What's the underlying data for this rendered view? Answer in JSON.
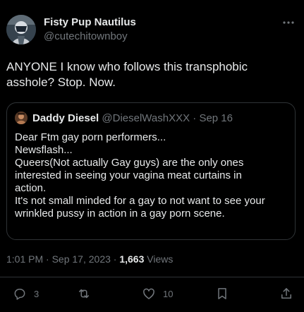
{
  "author": {
    "name": "Fisty Pup Nautilus",
    "handle": "@cutechitownboy",
    "avatar_icon": "profile-photo"
  },
  "more_icon": "more-horizontal-icon",
  "tweet": {
    "text": "ANYONE I know who follows this transphobic\nasshole?  Stop. Now."
  },
  "quote": {
    "name": "Daddy Diesel",
    "handle": "@DieselWashXXX",
    "separator": " · ",
    "date": "Sep 16",
    "text": "Dear Ftm gay porn performers...\nNewsflash...\nQueers(Not actually Gay guys) are the only ones\ninterested in seeing your vagina meat curtains in\naction.\nIt's not small minded for a gay to not want to see your\nwrinkled pussy in action in a gay porn scene."
  },
  "meta": {
    "time": "1:01 PM",
    "sep1": " · ",
    "date": "Sep 17, 2023",
    "sep2": " · ",
    "views_count": "1,663",
    "views_label": " Views"
  },
  "actions": {
    "reply_count": "3",
    "retweet_count": "",
    "like_count": "10"
  },
  "colors": {
    "background": "#000000",
    "text_primary": "#e7e9ea",
    "text_secondary": "#71767b",
    "border": "#2f3336"
  }
}
